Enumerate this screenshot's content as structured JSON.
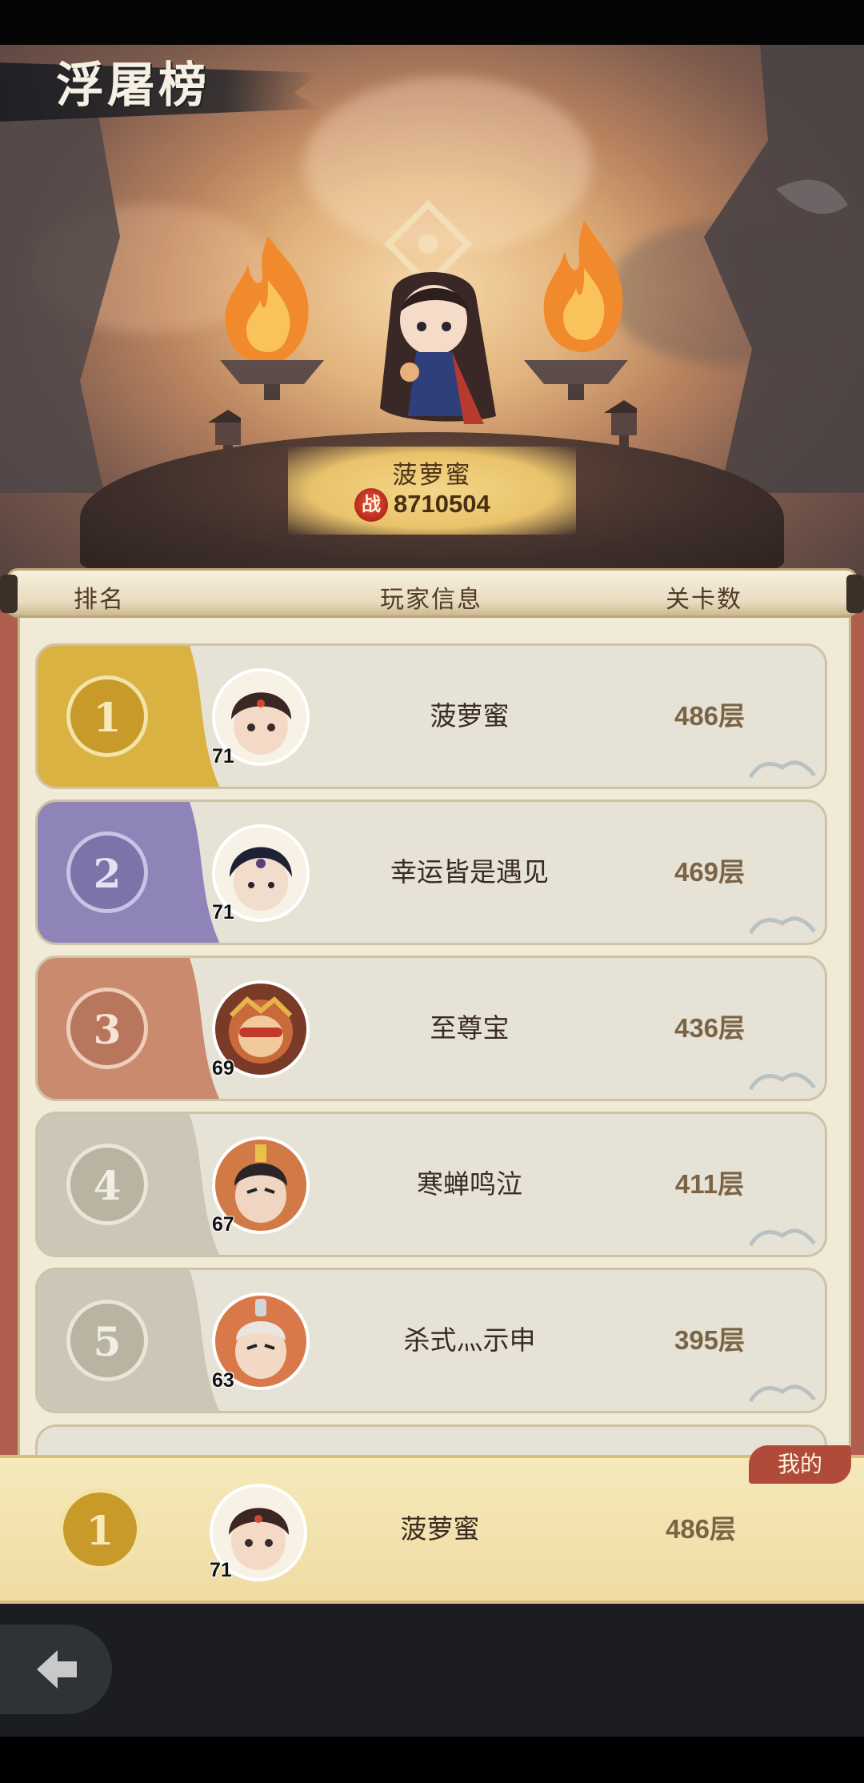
{
  "header": {
    "title": "浮屠榜"
  },
  "champion": {
    "name": "菠萝蜜",
    "power_icon_text": "战",
    "power": "8710504"
  },
  "columns": {
    "rank": "排名",
    "player": "玩家信息",
    "floors": "关卡数"
  },
  "ranking": [
    {
      "rank": "1",
      "level": "71",
      "name": "菠萝蜜",
      "floors": "486层",
      "tier": "gold"
    },
    {
      "rank": "2",
      "level": "71",
      "name": "幸运皆是遇见",
      "floors": "469层",
      "tier": "purple"
    },
    {
      "rank": "3",
      "level": "69",
      "name": "至尊宝",
      "floors": "436层",
      "tier": "bronze"
    },
    {
      "rank": "4",
      "level": "67",
      "name": "寒蝉鸣泣",
      "floors": "411层",
      "tier": "grey"
    },
    {
      "rank": "5",
      "level": "63",
      "name": "杀式灬示申",
      "floors": "395层",
      "tier": "grey"
    }
  ],
  "mine": {
    "tag": "我的",
    "rank": "1",
    "level": "71",
    "name": "菠萝蜜",
    "floors": "486层"
  },
  "icons": {
    "back": "back-arrow-icon",
    "power": "flame-power-icon"
  },
  "colors": {
    "gold": "#d9b242",
    "purple": "#8f84b8",
    "bronze": "#c98a6e",
    "grey": "#cbc6b6",
    "panel_red": "#b05e4d",
    "paper": "#f0ead7"
  }
}
